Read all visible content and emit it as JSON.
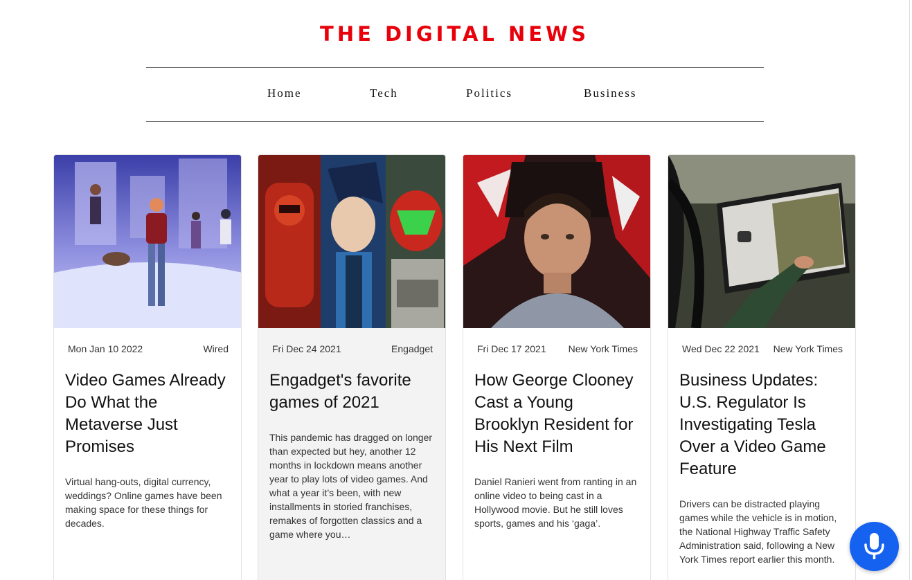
{
  "site": {
    "title": "THE DIGITAL NEWS",
    "accent_color": "#e8000b"
  },
  "nav": {
    "items": [
      {
        "label": "Home"
      },
      {
        "label": "Tech"
      },
      {
        "label": "Politics"
      },
      {
        "label": "Business"
      }
    ]
  },
  "articles": [
    {
      "image": "metaverse-avatars-snow-scene",
      "date": "Mon Jan 10 2022",
      "source": "Wired",
      "title": "Video Games Already Do What the Metaverse Just Promises",
      "description": "Virtual hang-outs, digital currency, weddings? Online games have been making space for these things for decades."
    },
    {
      "image": "game-characters-collage",
      "date": "Fri Dec 24 2021",
      "source": "Engadget",
      "title": "Engadget's favorite games of 2021",
      "description": "This pandemic has dragged on longer than expected but hey, another 12 months in lockdown means another year to play lots of video games. And what a year it’s been, with new installments in storied franchises, remakes of forgotten classics and a game where you…"
    },
    {
      "image": "boy-portrait",
      "date": "Fri Dec 17 2021",
      "source": "New York Times",
      "title": "How George Clooney Cast a Young Brooklyn Resident for His Next Film",
      "description": "Daniel Ranieri went from ranting in an online video to being cast in a Hollywood movie. But he still loves sports, games and his ‘gaga’."
    },
    {
      "image": "car-touchscreen-game",
      "date": "Wed Dec 22 2021",
      "source": "New York Times",
      "title": "Business Updates: U.S. Regulator Is Investigating Tesla Over a Video Game Feature",
      "description": "Drivers can be distracted playing games while the vehicle is in motion, the National Highway Traffic Safety Administration said, following a New York Times report earlier this month."
    }
  ],
  "voice_button": {
    "icon": "microphone-icon",
    "color": "#1562f0"
  }
}
